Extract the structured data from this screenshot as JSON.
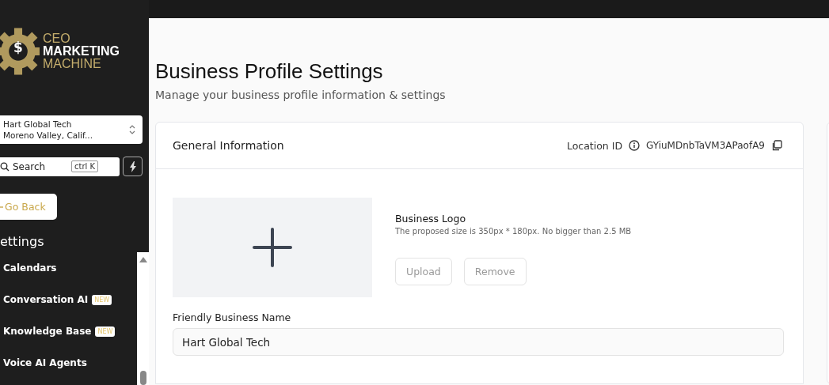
{
  "sidebar": {
    "logo": {
      "symbol": "$",
      "lines": [
        "CEO",
        "MARKETING",
        "MACHINE"
      ]
    },
    "account": {
      "name": "Hart Global Tech",
      "location": "Moreno Valley, Calif..."
    },
    "search": {
      "placeholder": "Search",
      "shortcut": "ctrl K"
    },
    "go_back": "Go Back",
    "section_title": "ettings",
    "menu": [
      {
        "label": "Calendars"
      },
      {
        "label": "Conversation AI",
        "badge": "NEW"
      },
      {
        "label": "Knowledge Base",
        "badge": "NEW"
      },
      {
        "label": "Voice AI Agents"
      }
    ]
  },
  "page": {
    "title": "Business Profile Settings",
    "subtitle": "Manage your business profile information & settings"
  },
  "card": {
    "title": "General Information",
    "location_id_label": "Location ID",
    "location_id": "GYiuMDnbTaVM3APaofA9",
    "logo": {
      "label": "Business Logo",
      "hint": "The proposed size is 350px * 180px. No bigger than 2.5 MB",
      "buttons": [
        "Upload",
        "Remove"
      ]
    },
    "friendly_name": {
      "label": "Friendly Business Name",
      "value": "Hart Global Tech"
    }
  }
}
